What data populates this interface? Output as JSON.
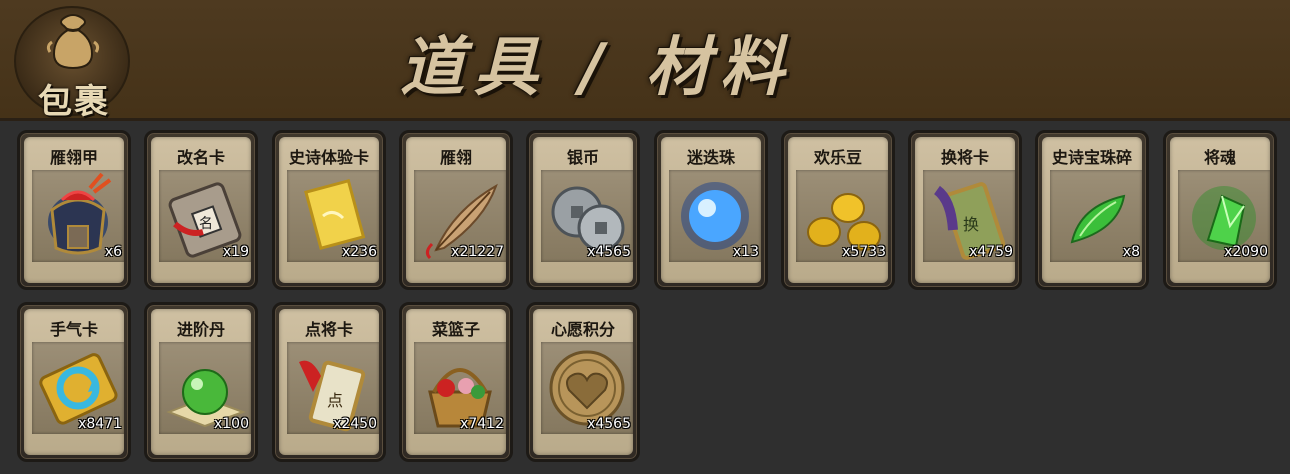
{
  "header": {
    "bag_label": "包裹",
    "title": "道具 / 材料"
  },
  "items": [
    {
      "name": "雁翎甲",
      "count": "x6",
      "icon": "armor-icon"
    },
    {
      "name": "改名卡",
      "count": "x19",
      "icon": "rename-card-icon"
    },
    {
      "name": "史诗体验卡",
      "count": "x236",
      "icon": "gold-card-icon"
    },
    {
      "name": "雁翎",
      "count": "x21227",
      "icon": "feather-icon"
    },
    {
      "name": "银币",
      "count": "x4565",
      "icon": "silver-coin-icon"
    },
    {
      "name": "迷迭珠",
      "count": "x13",
      "icon": "blue-orb-icon"
    },
    {
      "name": "欢乐豆",
      "count": "x5733",
      "icon": "gold-beans-icon"
    },
    {
      "name": "换将卡",
      "count": "x4759",
      "icon": "swap-card-icon"
    },
    {
      "name": "史诗宝珠碎",
      "count": "x8",
      "icon": "green-shard-icon"
    },
    {
      "name": "将魂",
      "count": "x2090",
      "icon": "green-crystal-icon"
    },
    {
      "name": "手气卡",
      "count": "x8471",
      "icon": "luck-card-icon"
    },
    {
      "name": "进阶丹",
      "count": "x100",
      "icon": "green-pill-icon"
    },
    {
      "name": "点将卡",
      "count": "x2450",
      "icon": "pick-card-icon"
    },
    {
      "name": "菜篮子",
      "count": "x7412",
      "icon": "basket-icon"
    },
    {
      "name": "心愿积分",
      "count": "x4565",
      "icon": "heart-coin-icon"
    }
  ]
}
